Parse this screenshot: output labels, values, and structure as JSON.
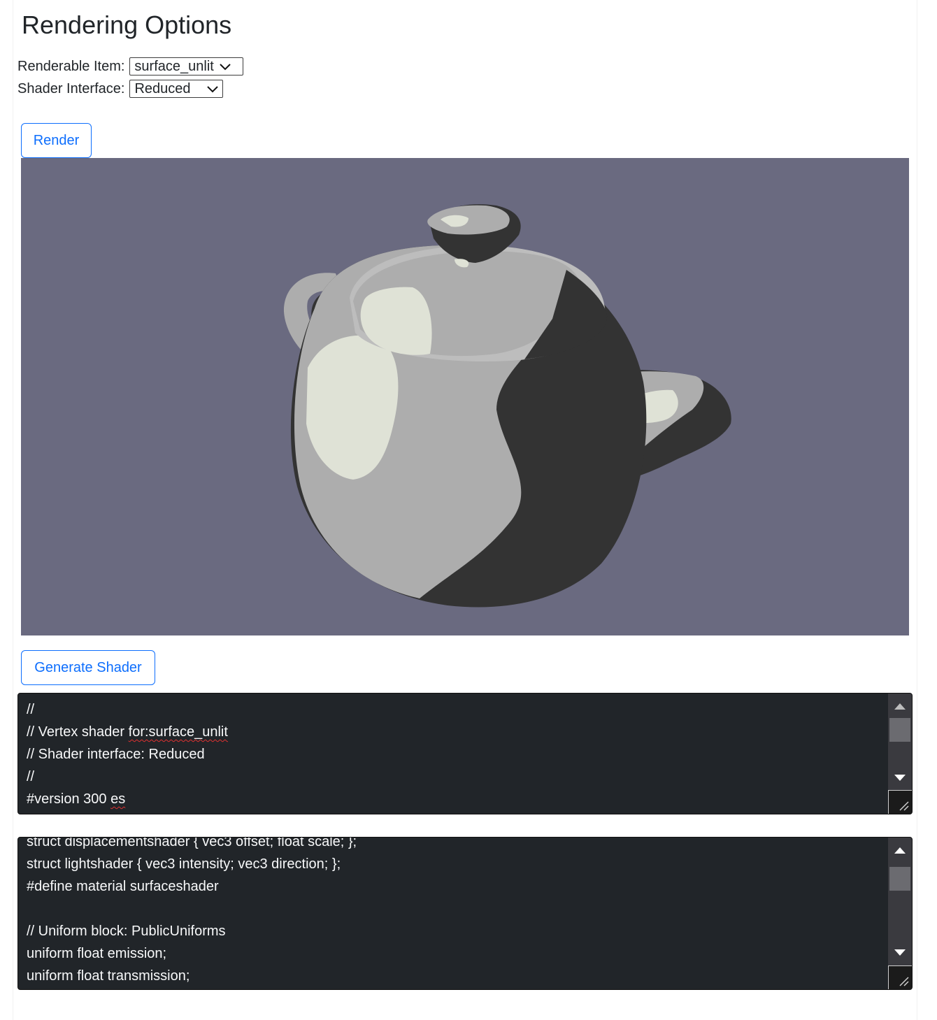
{
  "page_title": "Rendering Options",
  "options": {
    "renderable_item_label": "Renderable Item:",
    "renderable_item_value": "surface_unlit",
    "shader_interface_label": "Shader Interface:",
    "shader_interface_value": "Reduced"
  },
  "buttons": {
    "render_label": "Render",
    "generate_shader_label": "Generate Shader"
  },
  "viewport": {
    "background_color": "#6a6a80",
    "subject": "teapot"
  },
  "vertex_shader": {
    "lines": [
      "//",
      "// Vertex shader for:surface_unlit",
      "// Shader interface: Reduced",
      "//",
      "#version 300 es"
    ]
  },
  "pixel_shader": {
    "lines": [
      "struct displacementshader { vec3 offset; float scale; };",
      "struct lightshader { vec3 intensity; vec3 direction; };",
      "#define material surfaceshader",
      "",
      "// Uniform block: PublicUniforms",
      "uniform float emission;",
      "uniform float transmission;"
    ]
  },
  "colors": {
    "accent": "#0d6efd",
    "code_background": "#212529",
    "code_text": "#f8f9fa"
  }
}
